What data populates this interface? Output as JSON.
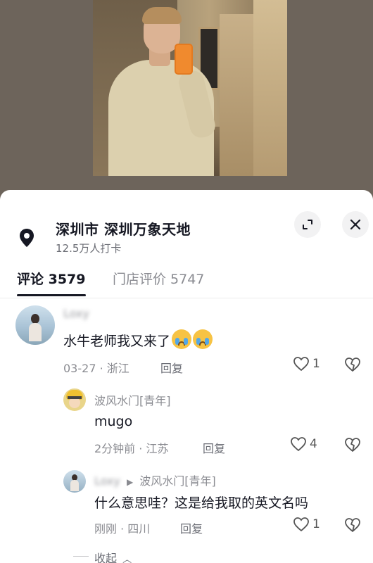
{
  "location": {
    "title": "深圳市  深圳万象天地",
    "subtitle": "12.5万人打卡"
  },
  "icons": {
    "pin": "location-pin-icon",
    "expand": "expand-icon",
    "close": "close-icon",
    "like": "heart-outline-icon",
    "dislike": "broken-heart-icon",
    "collapse": "chevron-up-icon"
  },
  "tabs": [
    {
      "label": "评论 3579"
    },
    {
      "label": "门店评价 5747"
    }
  ],
  "comments": [
    {
      "username": "Loxy",
      "text": "水牛老师我又来了",
      "date": "03-27 · 浙江",
      "reply_label": "回复",
      "likes": "1"
    },
    {
      "username": "波风水门[青年]",
      "text": "mugo",
      "date": "2分钟前 · 江苏",
      "reply_label": "回复",
      "likes": "4"
    },
    {
      "username": "Loxy",
      "reply_to": "波风水门[青年]",
      "text": "什么意思哇？这是给我取的英文名吗",
      "date": "刚刚 · 四川",
      "reply_label": "回复",
      "likes": "1"
    }
  ],
  "collapse_label": "收起",
  "colors": {
    "text_primary": "#161823",
    "text_secondary": "#8a8b91",
    "button_bg": "#f2f2f3"
  }
}
